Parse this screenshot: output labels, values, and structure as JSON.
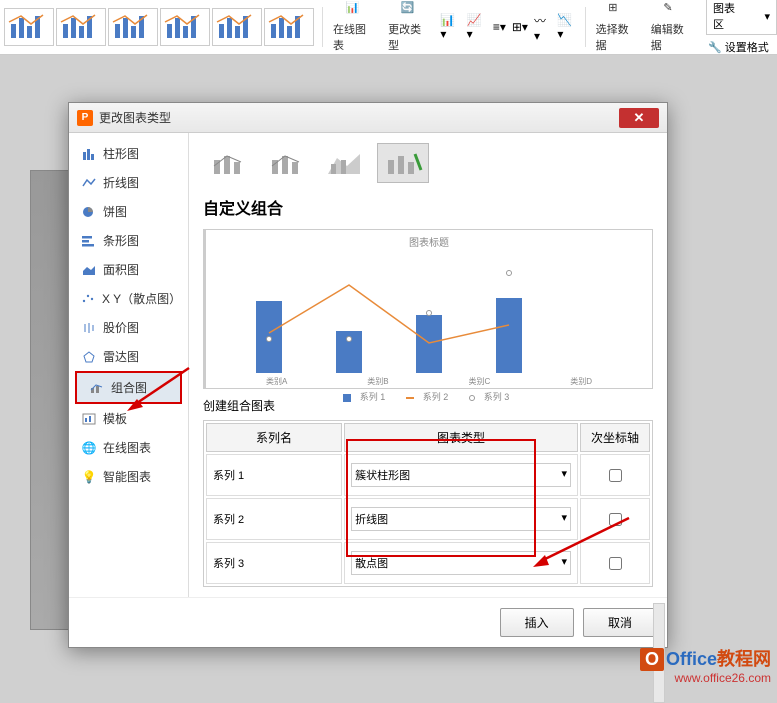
{
  "ribbon": {
    "onlineChart": "在线图表",
    "changeType": "更改类型",
    "selectData": "选择数据",
    "editData": "编辑数据",
    "chartArea": "图表区",
    "setFormat": "设置格式"
  },
  "dialog": {
    "title": "更改图表类型",
    "sidebar": {
      "items": [
        {
          "label": "柱形图"
        },
        {
          "label": "折线图"
        },
        {
          "label": "饼图"
        },
        {
          "label": "条形图"
        },
        {
          "label": "面积图"
        },
        {
          "label": "X Y（散点图）"
        },
        {
          "label": "股价图"
        },
        {
          "label": "雷达图"
        },
        {
          "label": "组合图"
        },
        {
          "label": "模板"
        },
        {
          "label": "在线图表"
        },
        {
          "label": "智能图表"
        }
      ]
    },
    "customComboTitle": "自定义组合",
    "previewTitle": "图表标题",
    "categories": [
      "类别A",
      "类别B",
      "类别C",
      "类别D"
    ],
    "legend": {
      "s1": "系列 1",
      "s2": "系列 2",
      "s3": "系列 3"
    },
    "createComboTitle": "创建组合图表",
    "table": {
      "headers": {
        "seriesName": "系列名",
        "chartType": "图表类型",
        "secondaryAxis": "次坐标轴"
      },
      "rows": [
        {
          "name": "系列 1",
          "type": "簇状柱形图",
          "secondary": false
        },
        {
          "name": "系列 2",
          "type": "折线图",
          "secondary": false
        },
        {
          "name": "系列 3",
          "type": "散点图",
          "secondary": false
        }
      ]
    },
    "buttons": {
      "insert": "插入",
      "cancel": "取消"
    }
  },
  "chart_data": {
    "type": "bar+line+scatter",
    "title": "图表标题",
    "categories": [
      "类别A",
      "类别B",
      "类别C",
      "类别D"
    ],
    "series": [
      {
        "name": "系列 1",
        "type": "bar",
        "values": [
          4.3,
          2.5,
          3.5,
          4.5
        ]
      },
      {
        "name": "系列 2",
        "type": "line",
        "values": [
          2.4,
          4.4,
          1.8,
          2.8
        ]
      },
      {
        "name": "系列 3",
        "type": "scatter",
        "values": [
          2.0,
          2.0,
          3.0,
          5.0
        ]
      }
    ],
    "ylim": [
      0,
      6
    ],
    "xlabel": "",
    "ylabel": ""
  },
  "watermark": {
    "line1a": "Office",
    "line1b": "教程网",
    "line2": "www.office26.com"
  }
}
